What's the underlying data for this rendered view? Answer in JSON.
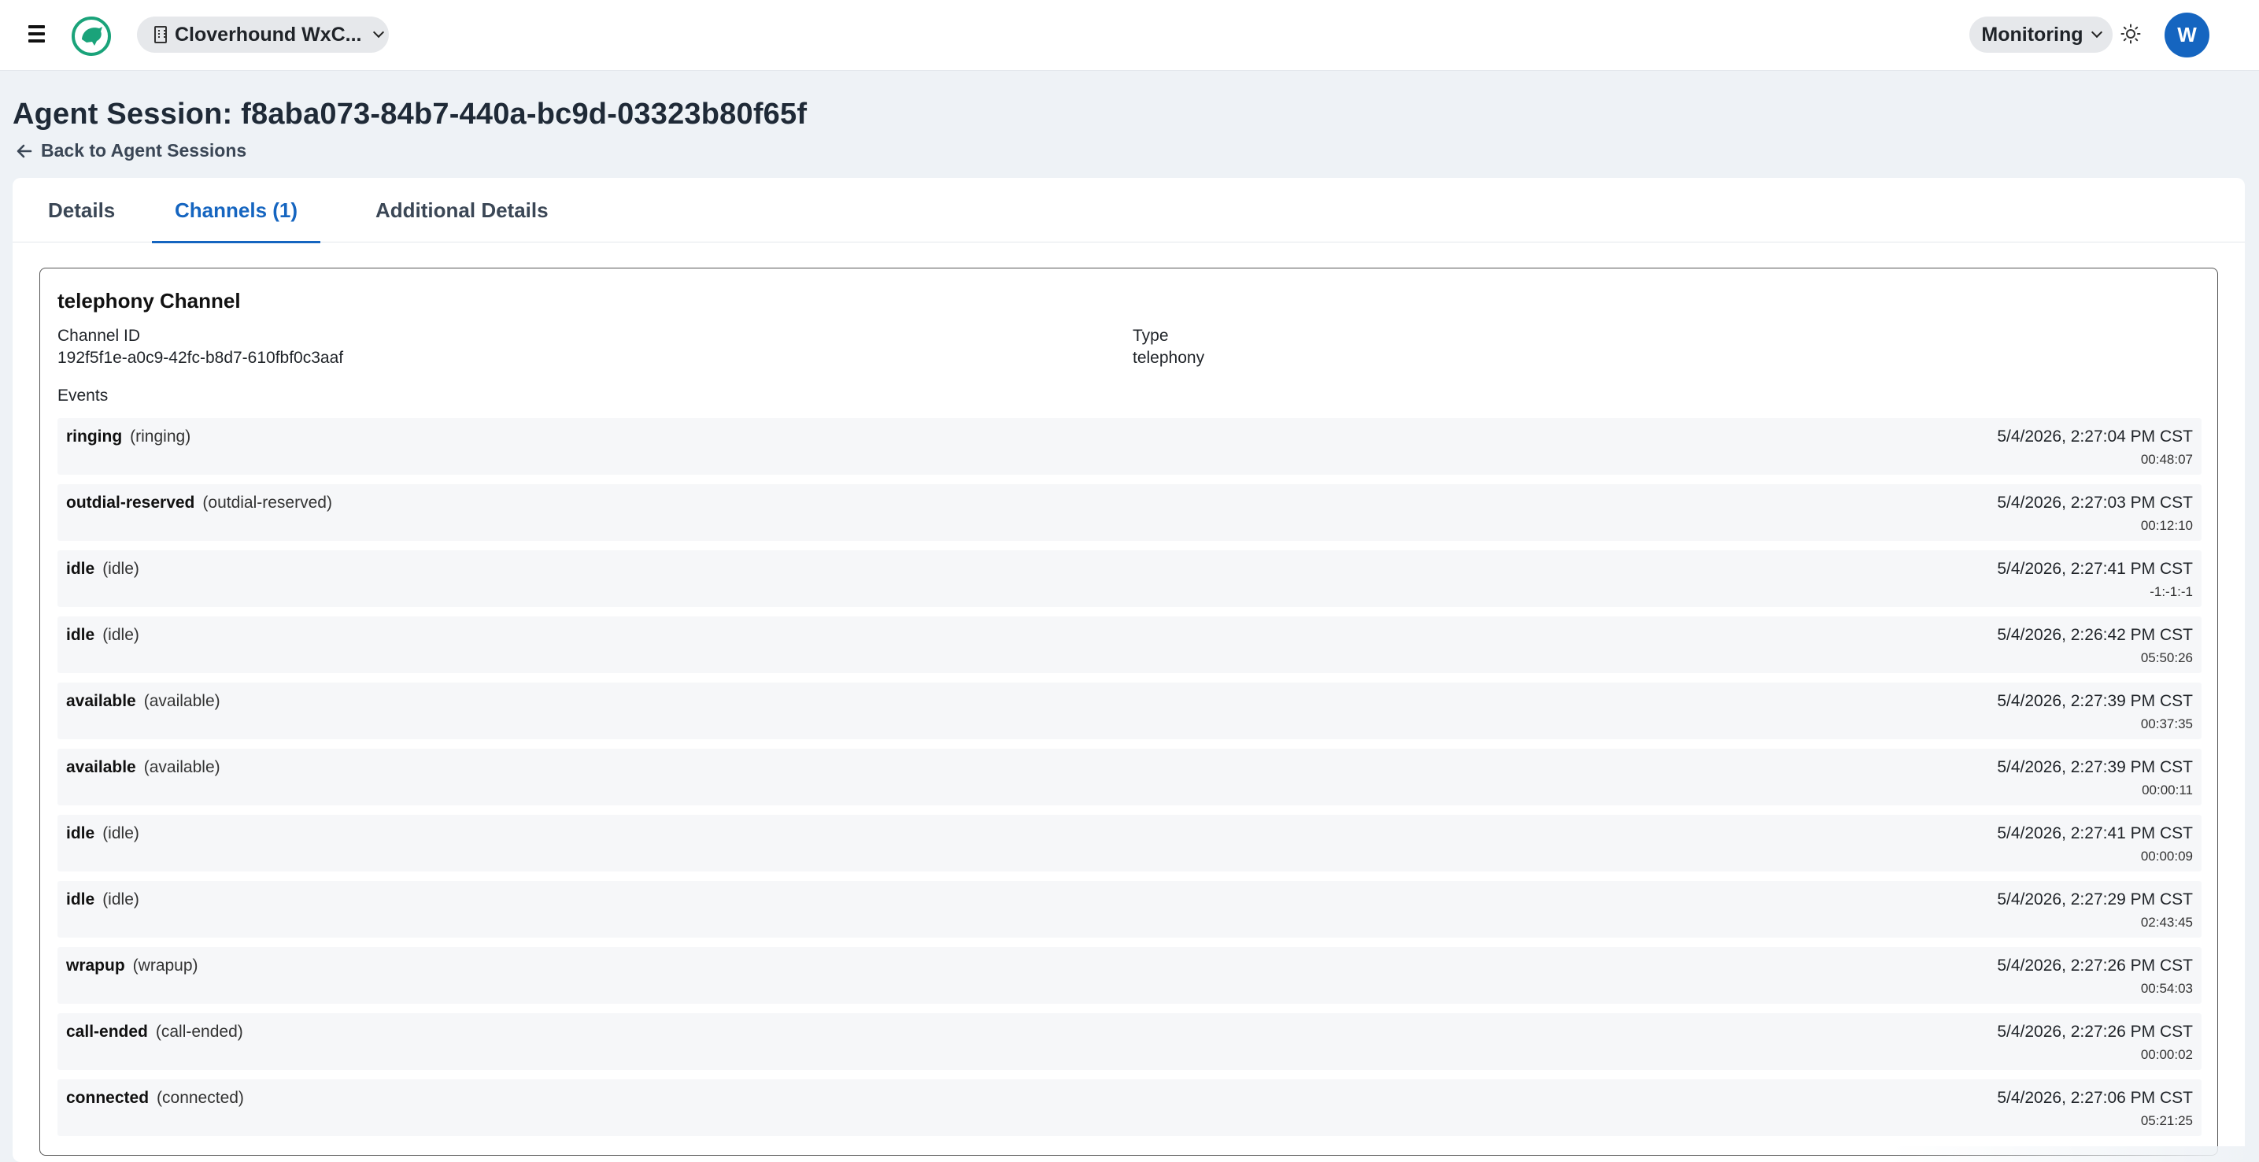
{
  "header": {
    "org_name": "Cloverhound WxC...",
    "mode_label": "Monitoring",
    "avatar_initial": "W"
  },
  "page": {
    "title": "Agent Session: f8aba073-84b7-440a-bc9d-03323b80f65f",
    "back_label": "Back to Agent Sessions"
  },
  "tabs": [
    {
      "label": "Details",
      "active": false
    },
    {
      "label": "Channels (1)",
      "active": true
    },
    {
      "label": "Additional Details",
      "active": false
    }
  ],
  "channel": {
    "title": "telephony Channel",
    "id_label": "Channel ID",
    "id_value": "192f5f1e-a0c9-42fc-b8d7-610fbf0c3aaf",
    "type_label": "Type",
    "type_value": "telephony",
    "events_label": "Events",
    "events": [
      {
        "name": "ringing",
        "type": "(ringing)",
        "time": "5/4/2026, 2:27:04 PM CST",
        "duration": "00:48:07"
      },
      {
        "name": "outdial-reserved",
        "type": "(outdial-reserved)",
        "time": "5/4/2026, 2:27:03 PM CST",
        "duration": "00:12:10"
      },
      {
        "name": "idle",
        "type": "(idle)",
        "time": "5/4/2026, 2:27:41 PM CST",
        "duration": "-1:-1:-1"
      },
      {
        "name": "idle",
        "type": "(idle)",
        "time": "5/4/2026, 2:26:42 PM CST",
        "duration": "05:50:26"
      },
      {
        "name": "available",
        "type": "(available)",
        "time": "5/4/2026, 2:27:39 PM CST",
        "duration": "00:37:35"
      },
      {
        "name": "available",
        "type": "(available)",
        "time": "5/4/2026, 2:27:39 PM CST",
        "duration": "00:00:11"
      },
      {
        "name": "idle",
        "type": "(idle)",
        "time": "5/4/2026, 2:27:41 PM CST",
        "duration": "00:00:09"
      },
      {
        "name": "idle",
        "type": "(idle)",
        "time": "5/4/2026, 2:27:29 PM CST",
        "duration": "02:43:45"
      },
      {
        "name": "wrapup",
        "type": "(wrapup)",
        "time": "5/4/2026, 2:27:26 PM CST",
        "duration": "00:54:03"
      },
      {
        "name": "call-ended",
        "type": "(call-ended)",
        "time": "5/4/2026, 2:27:26 PM CST",
        "duration": "00:00:02"
      },
      {
        "name": "connected",
        "type": "(connected)",
        "time": "5/4/2026, 2:27:06 PM CST",
        "duration": "05:21:25"
      }
    ]
  },
  "colors": {
    "accent": "#1565c0",
    "logo_green": "#1aa37a",
    "page_bg": "#eef2f6"
  }
}
